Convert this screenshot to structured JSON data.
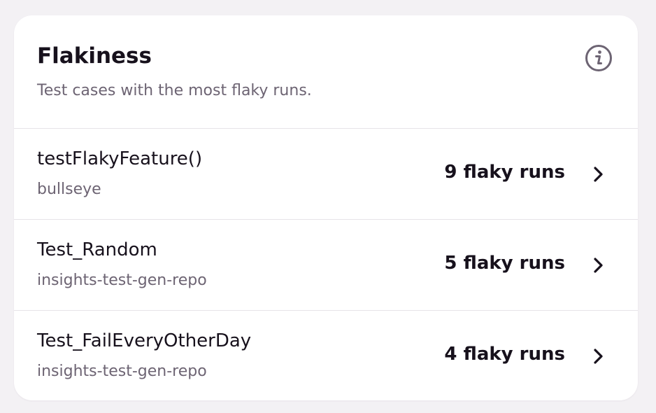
{
  "panel": {
    "title": "Flakiness",
    "subtitle": "Test cases with the most flaky runs.",
    "info_icon": "info-icon"
  },
  "tests": [
    {
      "name": "testFlakyFeature()",
      "repo": "bullseye",
      "flaky_runs": "9 flaky runs",
      "icon": "chevron-right-icon"
    },
    {
      "name": "Test_Random",
      "repo": "insights-test-gen-repo",
      "flaky_runs": "5 flaky runs",
      "icon": "chevron-right-icon"
    },
    {
      "name": "Test_FailEveryOtherDay",
      "repo": "insights-test-gen-repo",
      "flaky_runs": "4 flaky runs",
      "icon": "chevron-right-icon"
    }
  ],
  "colors": {
    "background": "#f3f1f4",
    "card": "#ffffff",
    "primary_text": "#17111c",
    "secondary_text": "#6d6473",
    "divider": "#e6e3e8",
    "icon": "#6d6473"
  }
}
